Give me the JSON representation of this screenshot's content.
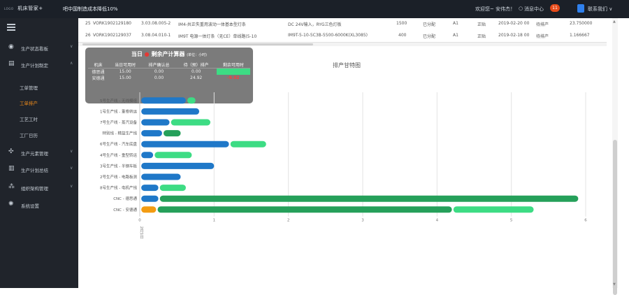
{
  "topbar": {
    "logo_small": "LOGO",
    "logo": "机床管家+",
    "marquee": "吧中国制造成本降低10%",
    "welcome": "欢迎您~ 安伟杰！",
    "bell_icon": "bell-icon",
    "messages": "消息中心",
    "message_count": "11",
    "profile": "联系我们 ∨"
  },
  "sidebar": {
    "items": [
      {
        "label": "生产状态看板",
        "icon": "eye-icon"
      },
      {
        "label": "生产计划制定",
        "icon": "clipboard-icon"
      },
      {
        "label": "生产元素管理",
        "icon": "gear-icon"
      },
      {
        "label": "生产计划总结",
        "icon": "chart-icon"
      },
      {
        "label": "组织架构管理",
        "icon": "org-icon"
      },
      {
        "label": "系统设置",
        "icon": "settings-icon"
      }
    ],
    "subitems": [
      {
        "label": "工单管理",
        "active": false
      },
      {
        "label": "工单排产",
        "active": true
      },
      {
        "label": "工艺工时",
        "active": false
      },
      {
        "label": "工厂日历",
        "active": false
      }
    ]
  },
  "table": {
    "rows": [
      [
        "25",
        "VORK1902129180",
        "3.03.08.005-2",
        "IM4-共正失重用波动一体基本型灯条",
        "DC 24V输入，RYG三色灯板",
        "1500",
        "已分配",
        "A1",
        "正贴",
        "2019-02-20 00",
        "待排产",
        "23.750000"
      ],
      [
        "26",
        "VORK1902129037",
        "3.08.04.010-1",
        "IM9T 电源一体灯条（无CE）单线路(5-10",
        "IM9T-5-10-5C3B-5500-6000K(XL3085)",
        "400",
        "已分配",
        "A1",
        "正贴",
        "2019-02-18 00",
        "待排产",
        "1.166667"
      ]
    ]
  },
  "calculator": {
    "title": "当日",
    "title2": "剩余产计算器",
    "note": "(单位：小时)",
    "headers": [
      "机床",
      "当日可用时",
      "排产确认总",
      "待（预）排产",
      "剩余可用时"
    ],
    "rows": [
      {
        "machine": "德思通",
        "available": "15.00",
        "confirmed": "0.00",
        "pending": "0.00",
        "remaining": "15.00",
        "status": "ok"
      },
      {
        "machine": "安德通",
        "available": "15.00",
        "confirmed": "0.00",
        "pending": "24.92",
        "remaining": "-9.92",
        "status": "over"
      }
    ]
  },
  "chart_data": {
    "type": "gantt",
    "title": "排产甘特图",
    "x_ticks": [
      "0",
      "1",
      "2",
      "3",
      "4",
      "5",
      "6"
    ],
    "x_first_label": "2月1日",
    "xlim": [
      0,
      6
    ],
    "colors": {
      "scheduled": "#1f78c8",
      "pending": "#3ddc84",
      "done": "#25a05a",
      "special": "#f39c12"
    },
    "rows": [
      {
        "label": "5号生产线 - 无线模组",
        "segments": [
          {
            "start": 0.02,
            "end": 0.62,
            "status": "scheduled"
          },
          {
            "start": 0.64,
            "end": 0.75,
            "status": "pending"
          }
        ]
      },
      {
        "label": "1号生产线 - 重卷转运",
        "segments": [
          {
            "start": 0.02,
            "end": 0.8,
            "status": "scheduled"
          }
        ]
      },
      {
        "label": "7号生产线 - 蒸汽设备",
        "segments": [
          {
            "start": 0.02,
            "end": 0.4,
            "status": "scheduled"
          },
          {
            "start": 0.42,
            "end": 0.95,
            "status": "pending"
          }
        ]
      },
      {
        "label": "特别线 - 精益生产线",
        "segments": [
          {
            "start": 0.02,
            "end": 0.3,
            "status": "scheduled"
          },
          {
            "start": 0.32,
            "end": 0.55,
            "status": "done"
          }
        ]
      },
      {
        "label": "6号生产线 - 汽车底盘",
        "segments": [
          {
            "start": 0.02,
            "end": 1.2,
            "status": "scheduled"
          },
          {
            "start": 1.22,
            "end": 1.7,
            "status": "pending"
          }
        ]
      },
      {
        "label": "4号生产线 - 重型转运",
        "segments": [
          {
            "start": 0.02,
            "end": 0.18,
            "status": "scheduled"
          },
          {
            "start": 0.2,
            "end": 0.7,
            "status": "pending"
          }
        ]
      },
      {
        "label": "3号生产线 - 半钢车板",
        "segments": [
          {
            "start": 0.02,
            "end": 1.0,
            "status": "scheduled"
          }
        ]
      },
      {
        "label": "2号生产线 - 电路板测",
        "segments": [
          {
            "start": 0.02,
            "end": 0.55,
            "status": "scheduled"
          }
        ]
      },
      {
        "label": "8号生产线 - 电机产线",
        "segments": [
          {
            "start": 0.02,
            "end": 0.25,
            "status": "scheduled"
          },
          {
            "start": 0.27,
            "end": 0.62,
            "status": "pending"
          }
        ]
      },
      {
        "label": "CNC - 德思通",
        "segments": [
          {
            "start": 0.02,
            "end": 0.25,
            "status": "scheduled"
          },
          {
            "start": 0.27,
            "end": 5.9,
            "status": "done"
          }
        ]
      },
      {
        "label": "CNC - 安德通",
        "segments": [
          {
            "start": 0.02,
            "end": 0.22,
            "status": "special"
          },
          {
            "start": 0.24,
            "end": 4.2,
            "status": "done"
          },
          {
            "start": 4.22,
            "end": 5.3,
            "status": "pending"
          }
        ]
      }
    ]
  }
}
